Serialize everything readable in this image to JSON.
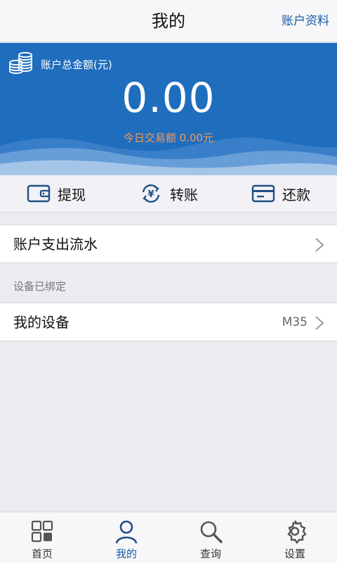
{
  "header": {
    "title": "我的",
    "right_link": "账户资料"
  },
  "account": {
    "label": "账户总金额(元)",
    "amount": "0.00",
    "today": "今日交易额  0.00元"
  },
  "actions": [
    {
      "label": "提现",
      "icon": "wallet-icon"
    },
    {
      "label": "转账",
      "icon": "yen-transfer-icon"
    },
    {
      "label": "还款",
      "icon": "card-icon"
    }
  ],
  "rows": {
    "flow": {
      "label": "账户支出流水"
    },
    "device_section": "设备已绑定",
    "device": {
      "label": "我的设备",
      "value": "M35"
    }
  },
  "tabs": [
    {
      "label": "首页",
      "icon": "grid-home-icon"
    },
    {
      "label": "我的",
      "icon": "person-icon"
    },
    {
      "label": "查询",
      "icon": "search-icon"
    },
    {
      "label": "设置",
      "icon": "gear-icon"
    }
  ],
  "colors": {
    "brand": "#1f6dbd",
    "link": "#1a5aa6",
    "accent": "#f39a54"
  }
}
